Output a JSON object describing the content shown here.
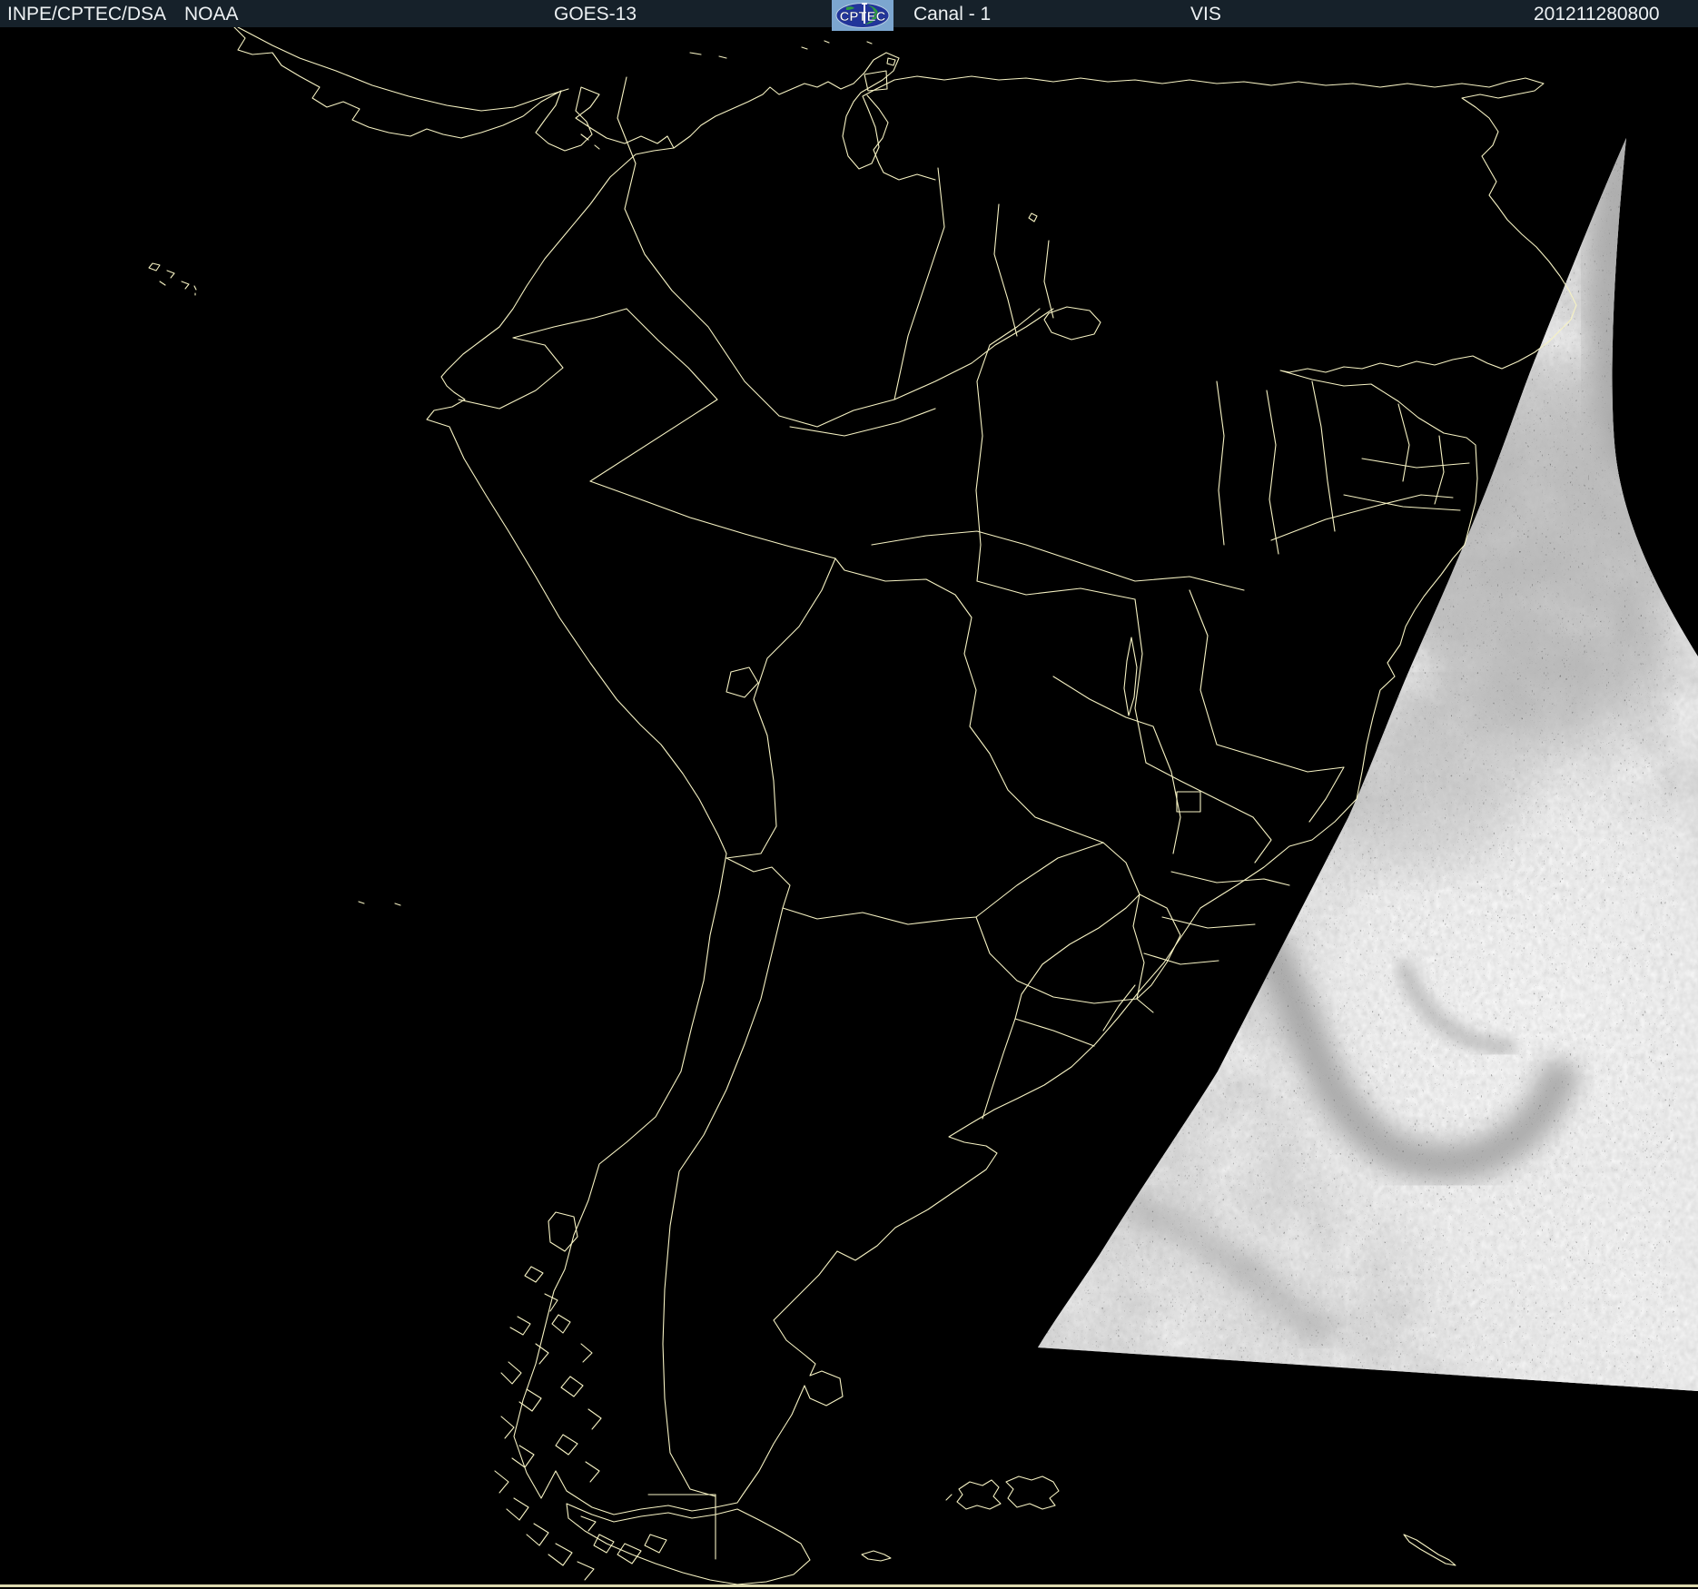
{
  "header": {
    "agency": "INPE/CPTEC/DSA",
    "organization": "NOAA",
    "satellite": "GOES-13",
    "logo_text": "CPTEC",
    "channel": "Canal - 1",
    "product_type": "VIS",
    "timestamp": "201211280800"
  },
  "colors": {
    "header_bg": "#16212a",
    "header_text": "#edf1f3",
    "map_line": "#f6f2c3",
    "sea_black": "#000000",
    "wedge_base": "#dcdcdc",
    "footer_line": "#efecc0",
    "logo_bg": "#7ca6cf",
    "logo_ellipse": "#22359a",
    "logo_land": "#2f9e40",
    "logo_text_color": "#ffffff"
  }
}
